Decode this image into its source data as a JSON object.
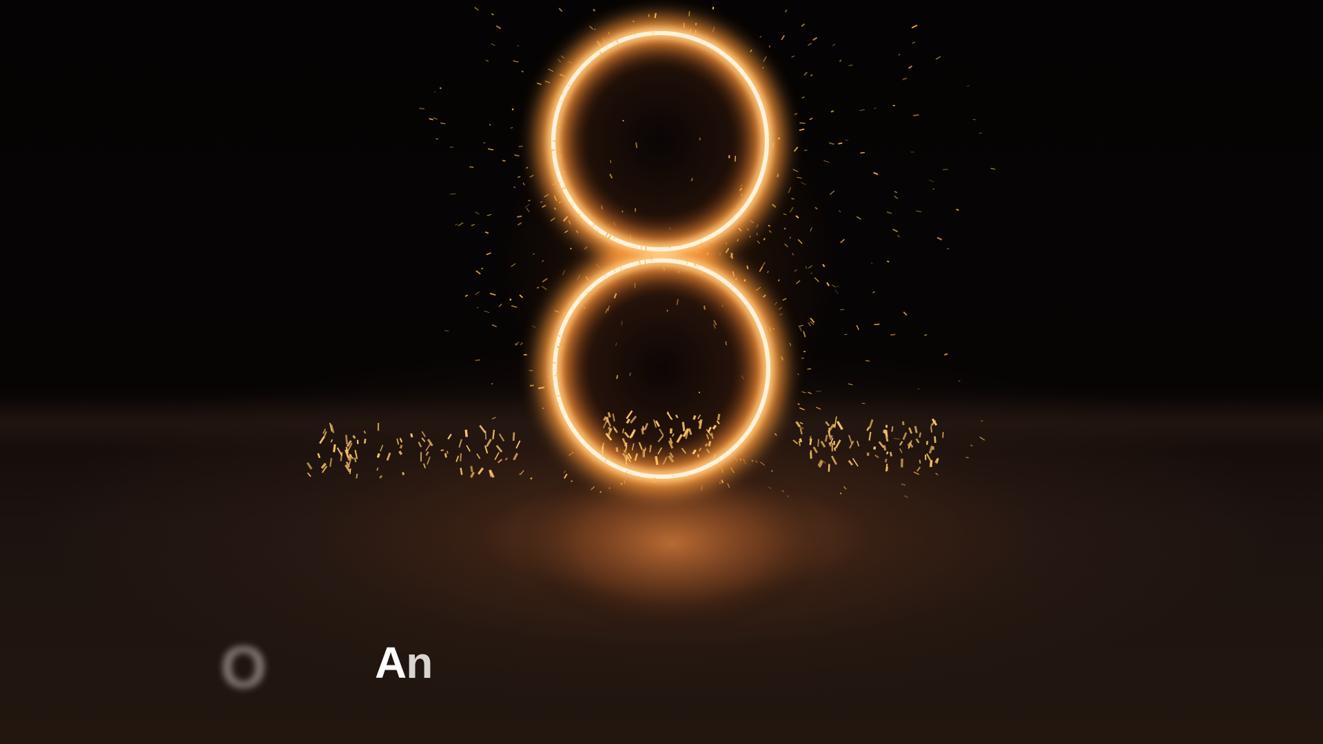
{
  "scene": {
    "subject": "glowing-figure-eight",
    "glow_color": "#ffb050",
    "core_color": "#fff3dc",
    "spark_color": "#ffb347",
    "floor_reflection_color": "#c06a30"
  },
  "caption": {
    "blurred_line": "",
    "blurred_letter": "O",
    "word_bold": "A",
    "word_rest": "n"
  }
}
